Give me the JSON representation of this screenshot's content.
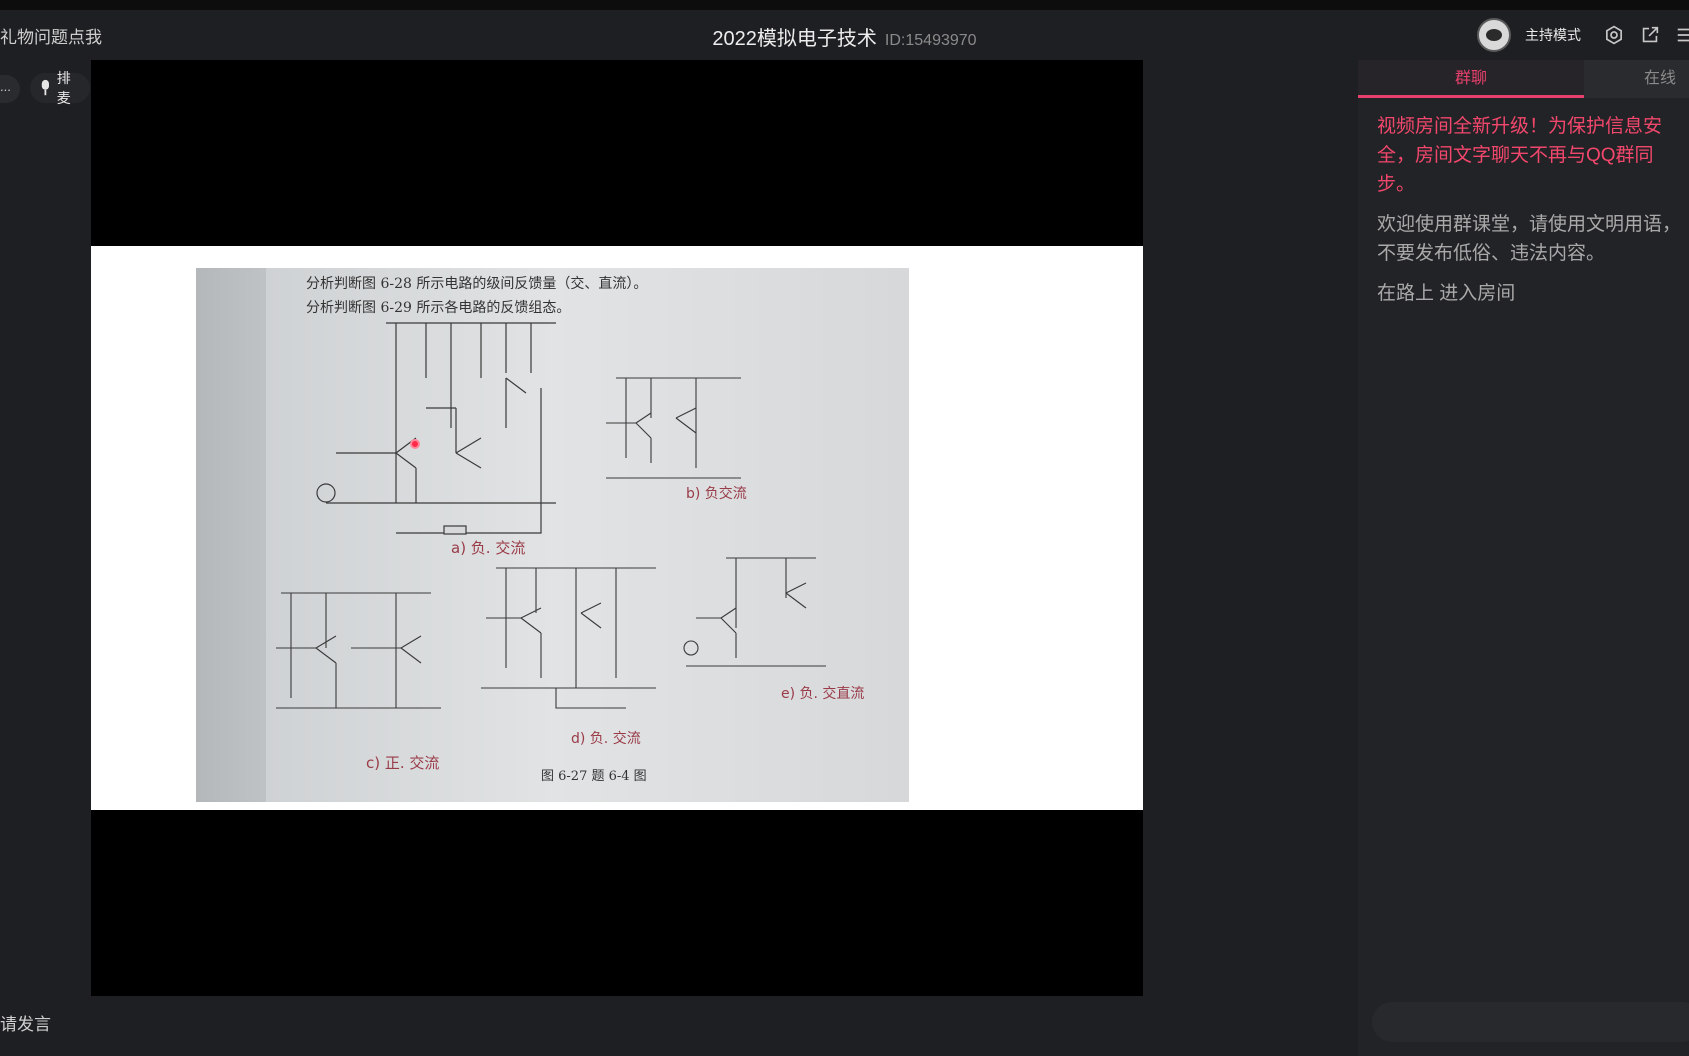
{
  "header": {
    "left_text": "礼物问题点我",
    "title": "2022模拟电子技术",
    "room_id": "ID:15493970",
    "host_mode_label": "主持模式",
    "icons": [
      "avatar",
      "settings-gear-icon",
      "external-link-icon",
      "menu-icon"
    ]
  },
  "left_panel": {
    "more_label": "...",
    "queue_label": "排麦",
    "speak_label": "请发言"
  },
  "slide": {
    "header_lines": [
      "分析判断图 6-28 所示电路的级间反馈量（交、直流）。",
      "分析判断图 6-29 所示各电路的反馈组态。"
    ],
    "sub_labels": [
      "a) 负. 交流",
      "b) 负交流",
      "c) 正. 交流",
      "d) 负. 交流",
      "e) 负. 交直流"
    ],
    "figure_caption": "图 6-27   题 6-4 图"
  },
  "chat": {
    "tabs": [
      {
        "label": "群聊",
        "active": true
      },
      {
        "label": "在线",
        "active": false
      }
    ],
    "messages": [
      {
        "type": "notice",
        "text": "视频房间全新升级！为保护信息安全，房间文字聊天不再与QQ群同步。"
      },
      {
        "type": "normal",
        "text": "欢迎使用群课堂，请使用文明用语，不要发布低俗、违法内容。"
      },
      {
        "type": "normal",
        "text": "在路上 进入房间"
      }
    ]
  },
  "colors": {
    "accent": "#e8406c",
    "notice_text": "#f2476c",
    "background": "#1e1f22",
    "stage": "#000000",
    "handwriting": "#9a3b48"
  }
}
